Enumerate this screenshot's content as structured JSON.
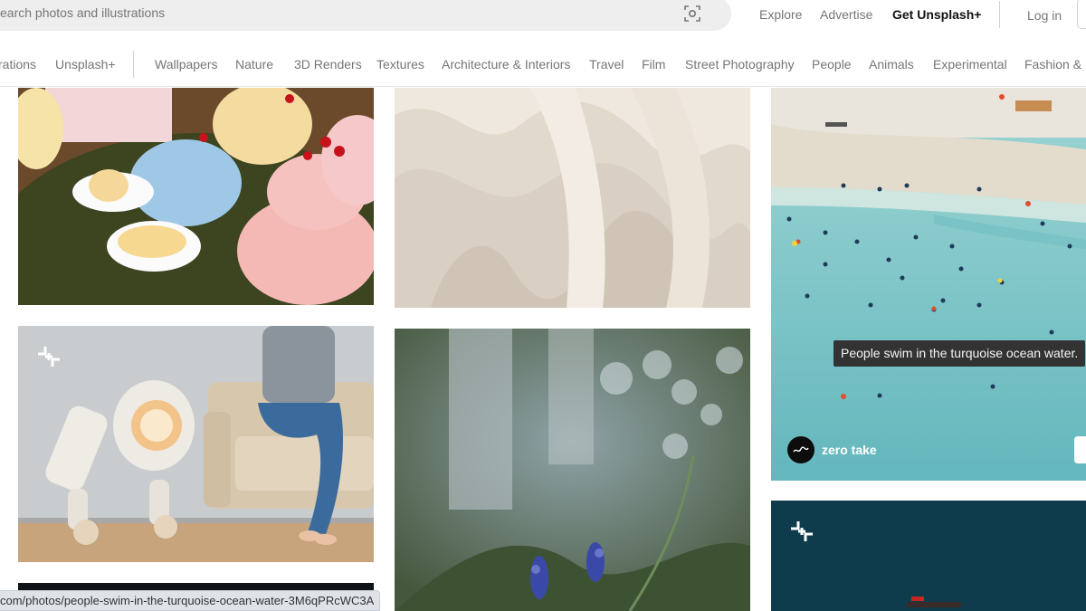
{
  "search": {
    "placeholder": "earch photos and illustrations"
  },
  "header": {
    "nav": [
      "Explore",
      "Advertise",
      "Get Unsplash+"
    ],
    "login": "Log in"
  },
  "topics": [
    "rations",
    "Unsplash+",
    "Wallpapers",
    "Nature",
    "3D Renders",
    "Textures",
    "Architecture & Interiors",
    "Travel",
    "Film",
    "Street Photography",
    "People",
    "Animals",
    "Experimental",
    "Fashion & B"
  ],
  "photos": {
    "cakes": {
      "alt": "pastel cakes on a table"
    },
    "ceramic_folds": {
      "alt": "white folded texture"
    },
    "robot_sofa": {
      "alt": "robot and person on sofa",
      "badge": "unsplash-plus-icon"
    },
    "bokeh_flowers": {
      "alt": "purple wildflowers with bokeh"
    },
    "ocean": {
      "tooltip": "People swim in the turquoise ocean water.",
      "author": "zero take"
    },
    "dark_sea": {
      "badge": "unsplash-plus-icon"
    }
  },
  "status_url": "com/photos/people-swim-in-the-turquoise-ocean-water-3M6qPRcWC3A",
  "colors": {
    "accent_text": "#111111",
    "muted_text": "#767676",
    "tooltip_bg": "#333333",
    "ocean": "#8ccfd0"
  }
}
